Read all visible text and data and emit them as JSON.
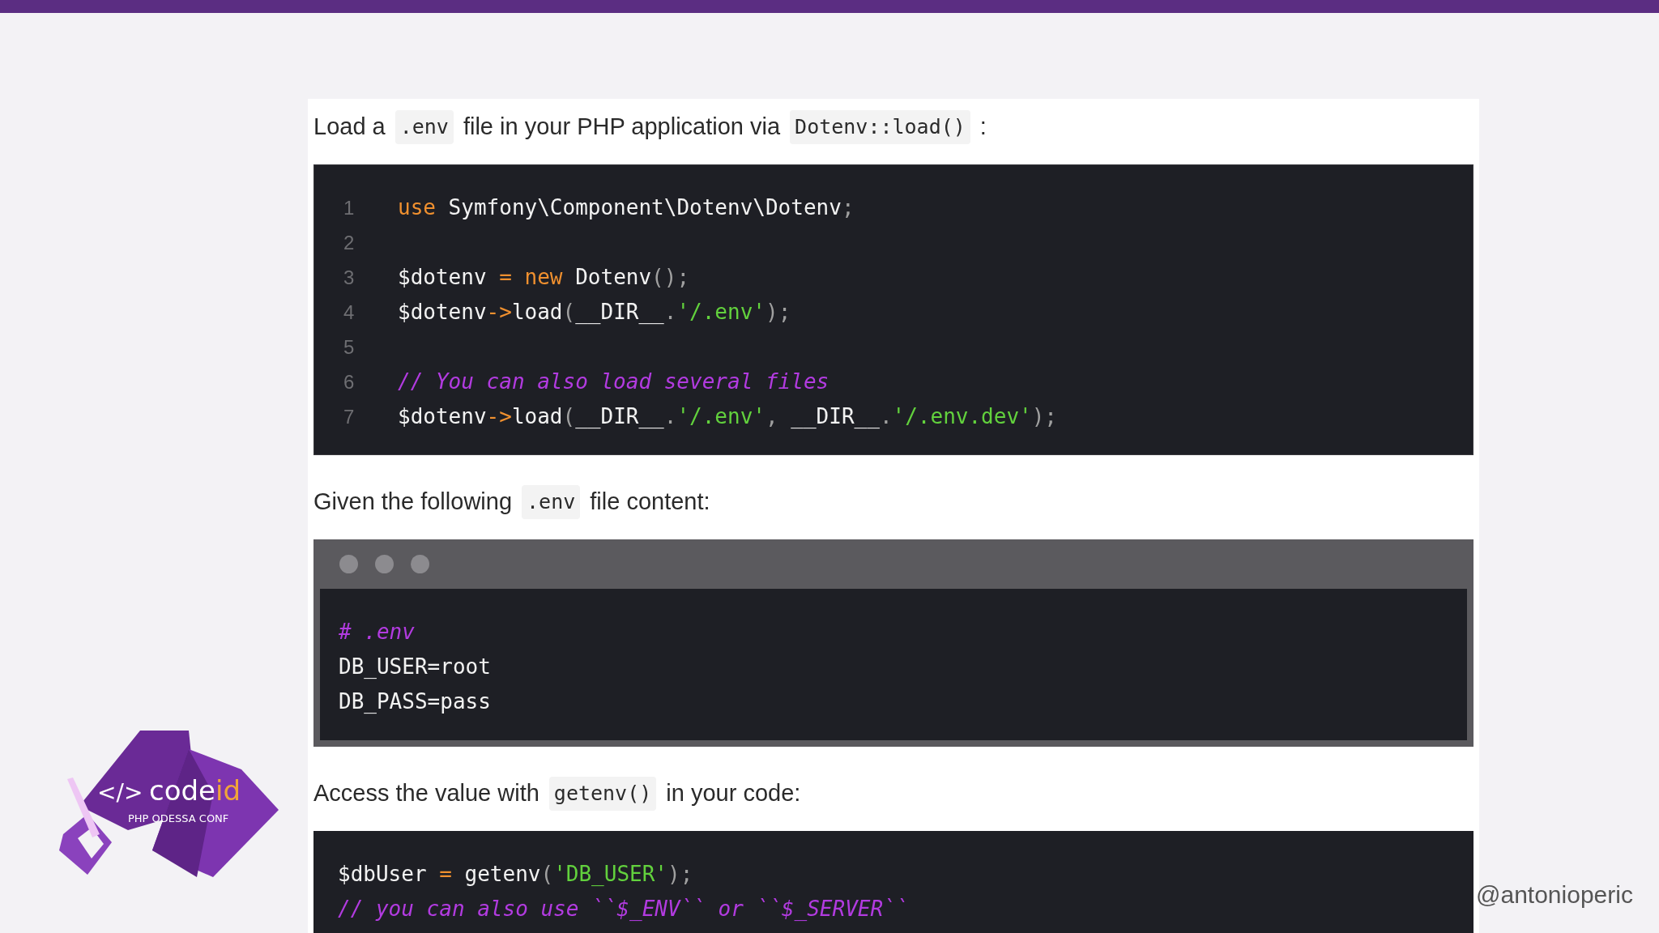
{
  "paragraphs": [
    {
      "segments": [
        {
          "kind": "text",
          "text": "Load a"
        },
        {
          "kind": "code",
          "text": ".env"
        },
        {
          "kind": "text",
          "text": "file in your PHP application via"
        },
        {
          "kind": "code",
          "text": "Dotenv::load()"
        },
        {
          "kind": "text",
          "text": ":"
        }
      ]
    },
    {
      "segments": [
        {
          "kind": "text",
          "text": "Given the following"
        },
        {
          "kind": "code",
          "text": ".env"
        },
        {
          "kind": "text",
          "text": "file content:"
        }
      ]
    },
    {
      "segments": [
        {
          "kind": "text",
          "text": "Access the value with"
        },
        {
          "kind": "code",
          "text": "getenv()"
        },
        {
          "kind": "text",
          "text": "in your code:"
        }
      ]
    }
  ],
  "code_blocks": [
    {
      "kind": "numbered",
      "lines": [
        {
          "number": "1",
          "tokens": [
            {
              "kind": "keyword",
              "text": "use"
            },
            {
              "kind": "plain",
              "text": " Symfony\\Component\\Dotenv\\Dotenv"
            },
            {
              "kind": "punct",
              "text": ";"
            }
          ]
        },
        {
          "number": "2"
        },
        {
          "number": "3",
          "tokens": [
            {
              "kind": "plain",
              "text": "$dotenv "
            },
            {
              "kind": "keyword",
              "text": "= new"
            },
            {
              "kind": "plain",
              "text": " Dotenv"
            },
            {
              "kind": "punct",
              "text": "();"
            }
          ]
        },
        {
          "number": "4",
          "tokens": [
            {
              "kind": "plain",
              "text": "$dotenv"
            },
            {
              "kind": "keyword",
              "text": "->"
            },
            {
              "kind": "plain",
              "text": "load"
            },
            {
              "kind": "punct",
              "text": "("
            },
            {
              "kind": "plain",
              "text": "__DIR__"
            },
            {
              "kind": "punct",
              "text": "."
            },
            {
              "kind": "string",
              "text": "'/.env'"
            },
            {
              "kind": "punct",
              "text": ");"
            }
          ]
        },
        {
          "number": "5"
        },
        {
          "number": "6",
          "tokens": [
            {
              "kind": "comment",
              "text": "// You can also load several files"
            }
          ]
        },
        {
          "number": "7",
          "tokens": [
            {
              "kind": "plain",
              "text": "$dotenv"
            },
            {
              "kind": "keyword",
              "text": "->"
            },
            {
              "kind": "plain",
              "text": "load"
            },
            {
              "kind": "punct",
              "text": "("
            },
            {
              "kind": "plain",
              "text": "__DIR__"
            },
            {
              "kind": "punct",
              "text": "."
            },
            {
              "kind": "string",
              "text": "'/.env'"
            },
            {
              "kind": "punct",
              "text": ", "
            },
            {
              "kind": "plain",
              "text": "__DIR__"
            },
            {
              "kind": "punct",
              "text": "."
            },
            {
              "kind": "string",
              "text": "'/.env.dev'"
            },
            {
              "kind": "punct",
              "text": ");"
            }
          ]
        }
      ]
    },
    {
      "kind": "terminal",
      "lines": [
        {
          "tokens": [
            {
              "kind": "comment",
              "text": "# .env"
            }
          ]
        },
        {
          "tokens": [
            {
              "kind": "plain",
              "text": "DB_USER=root"
            }
          ]
        },
        {
          "tokens": [
            {
              "kind": "plain",
              "text": "DB_PASS=pass"
            }
          ]
        }
      ]
    },
    {
      "kind": "plain",
      "lines": [
        {
          "tokens": [
            {
              "kind": "plain",
              "text": "$dbUser "
            },
            {
              "kind": "keyword",
              "text": "="
            },
            {
              "kind": "plain",
              "text": " getenv"
            },
            {
              "kind": "punct",
              "text": "("
            },
            {
              "kind": "string",
              "text": "'DB_USER'"
            },
            {
              "kind": "punct",
              "text": ");"
            }
          ]
        },
        {
          "tokens": [
            {
              "kind": "comment",
              "text": "// you can also use ``$_ENV`` or ``$_SERVER``"
            }
          ]
        }
      ]
    }
  ],
  "logo": {
    "mark": "</>",
    "word": "code",
    "word_accent": "id",
    "subtitle": "PHP ODESSA CONF"
  },
  "handle": "@antonioperic"
}
